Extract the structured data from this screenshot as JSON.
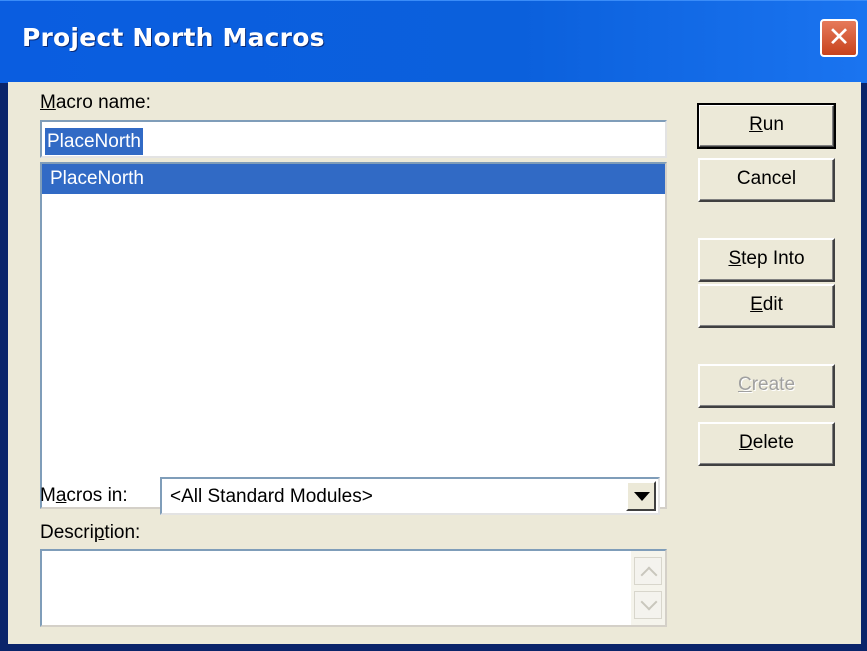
{
  "window": {
    "title": "Project North Macros",
    "close_glyph": "✕"
  },
  "form": {
    "macro_name_label": "acro name:",
    "macro_name_accel": "M",
    "macro_name_value": "PlaceNorth",
    "macro_list": [
      "PlaceNorth"
    ],
    "macros_in_label_pre": "M",
    "macros_in_label_accel": "a",
    "macros_in_label_post": "cros in:",
    "macros_in_value": "<All Standard Modules>",
    "description_label_pre": "Descri",
    "description_label_accel": "p",
    "description_label_post": "tion:",
    "description_value": ""
  },
  "buttons": {
    "run_accel": "R",
    "run_rest": "un",
    "cancel": "Cancel",
    "step_into_accel": "S",
    "step_into_rest": "tep Into",
    "edit_accel": "E",
    "edit_rest": "dit",
    "create_accel": "C",
    "create_rest": "reate",
    "delete_accel": "D",
    "delete_rest": "elete"
  },
  "icons": {
    "close": "close-icon",
    "dropdown": "chevron-down-icon",
    "scroll_up": "scroll-up-icon",
    "scroll_down": "scroll-down-icon"
  },
  "colors": {
    "titlebar": "#0a5de0",
    "selection": "#316ac5",
    "dialog_face": "#ece9d8",
    "close_button": "#c8431d"
  }
}
